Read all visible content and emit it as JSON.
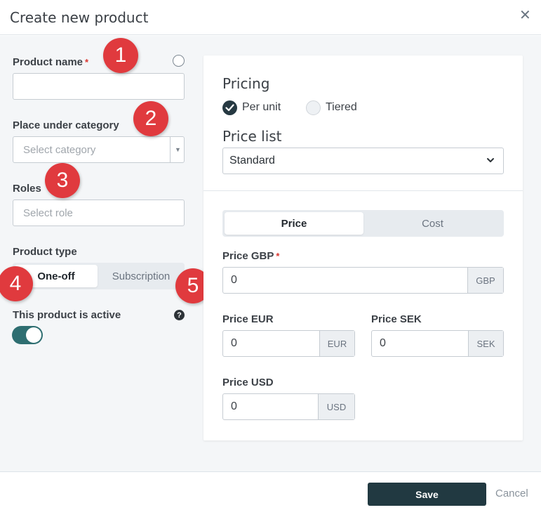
{
  "dialog": {
    "title": "Create new product",
    "close_icon": "close-icon"
  },
  "form": {
    "product_name": {
      "label": "Product name",
      "required_mark": "*",
      "value": ""
    },
    "category": {
      "label": "Place under category",
      "placeholder": "Select category"
    },
    "roles": {
      "label": "Roles",
      "placeholder": "Select role"
    },
    "product_type": {
      "label": "Product type",
      "options": [
        "One-off",
        "Subscription"
      ],
      "selected": "One-off"
    },
    "active": {
      "label": "This product is active",
      "help": "?",
      "on": true
    }
  },
  "badges": [
    "1",
    "2",
    "3",
    "4",
    "5"
  ],
  "pricing": {
    "title": "Pricing",
    "options": [
      "Per unit",
      "Tiered"
    ],
    "selected": "Per unit",
    "price_list": {
      "title": "Price list",
      "value": "Standard"
    },
    "tabs": [
      "Price",
      "Cost"
    ],
    "active_tab": "Price",
    "prices": [
      {
        "label": "Price GBP",
        "required_mark": "*",
        "value": "0",
        "currency": "GBP"
      },
      {
        "label": "Price EUR",
        "value": "0",
        "currency": "EUR"
      },
      {
        "label": "Price SEK",
        "value": "0",
        "currency": "SEK"
      },
      {
        "label": "Price USD",
        "value": "0",
        "currency": "USD"
      }
    ]
  },
  "footer": {
    "save": "Save",
    "cancel": "Cancel"
  },
  "colors": {
    "primary": "#213941",
    "toggle": "#2e6e71",
    "badge": "#e03a3e",
    "required": "#d9352f"
  }
}
